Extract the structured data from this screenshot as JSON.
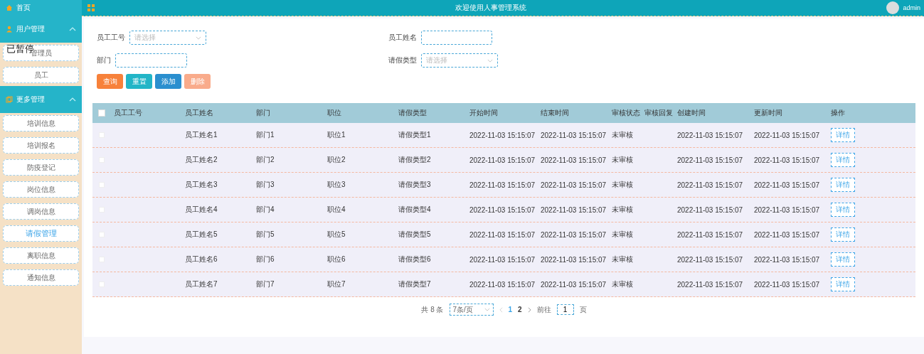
{
  "sidebar": {
    "home": "首页",
    "groups": [
      {
        "label": "用户管理",
        "expanded": true,
        "items": [
          {
            "label": "管理员",
            "selected": false
          },
          {
            "label": "员工",
            "selected": false
          }
        ]
      },
      {
        "label": "更多管理",
        "expanded": true,
        "items": [
          {
            "label": "培训信息",
            "selected": false
          },
          {
            "label": "培训报名",
            "selected": false
          },
          {
            "label": "防疫登记",
            "selected": false
          },
          {
            "label": "岗位信息",
            "selected": false
          },
          {
            "label": "调岗信息",
            "selected": false
          },
          {
            "label": "请假管理",
            "selected": true
          },
          {
            "label": "离职信息",
            "selected": false
          },
          {
            "label": "通知信息",
            "selected": false
          }
        ]
      }
    ]
  },
  "overlay": "已暂停",
  "header": {
    "title": "欢迎使用人事管理系统",
    "user": "admin"
  },
  "filters": [
    {
      "label": "员工工号",
      "kind": "select",
      "placeholder": "请选择"
    },
    {
      "label": "员工姓名",
      "kind": "input"
    },
    {
      "label": "部门",
      "kind": "input"
    },
    {
      "label": "请假类型",
      "kind": "select",
      "placeholder": "请选择"
    }
  ],
  "buttons": [
    {
      "label": "查询",
      "kind": "search"
    },
    {
      "label": "重置",
      "kind": "reset"
    },
    {
      "label": "添加",
      "kind": "add"
    },
    {
      "label": "删除",
      "kind": "delete"
    }
  ],
  "table": {
    "all_checked": false,
    "columns": [
      "员工工号",
      "员工姓名",
      "部门",
      "职位",
      "请假类型",
      "开始时间",
      "结束时间",
      "审核状态",
      "审核回复",
      "创建时间",
      "更新时间",
      "操作"
    ],
    "rows": [
      {
        "checked": false,
        "cells": [
          "",
          "员工姓名1",
          "部门1",
          "职位1",
          "请假类型1",
          "2022-11-03 15:15:07",
          "2022-11-03 15:15:07",
          "未审核",
          "",
          "2022-11-03 15:15:07",
          "2022-11-03 15:15:07"
        ],
        "action": "详情"
      },
      {
        "checked": false,
        "cells": [
          "",
          "员工姓名2",
          "部门2",
          "职位2",
          "请假类型2",
          "2022-11-03 15:15:07",
          "2022-11-03 15:15:07",
          "未审核",
          "",
          "2022-11-03 15:15:07",
          "2022-11-03 15:15:07"
        ],
        "action": "详情"
      },
      {
        "checked": false,
        "cells": [
          "",
          "员工姓名3",
          "部门3",
          "职位3",
          "请假类型3",
          "2022-11-03 15:15:07",
          "2022-11-03 15:15:07",
          "未审核",
          "",
          "2022-11-03 15:15:07",
          "2022-11-03 15:15:07"
        ],
        "action": "详情"
      },
      {
        "checked": false,
        "cells": [
          "",
          "员工姓名4",
          "部门4",
          "职位4",
          "请假类型4",
          "2022-11-03 15:15:07",
          "2022-11-03 15:15:07",
          "未审核",
          "",
          "2022-11-03 15:15:07",
          "2022-11-03 15:15:07"
        ],
        "action": "详情"
      },
      {
        "checked": false,
        "cells": [
          "",
          "员工姓名5",
          "部门5",
          "职位5",
          "请假类型5",
          "2022-11-03 15:15:07",
          "2022-11-03 15:15:07",
          "未审核",
          "",
          "2022-11-03 15:15:07",
          "2022-11-03 15:15:07"
        ],
        "action": "详情"
      },
      {
        "checked": false,
        "cells": [
          "",
          "员工姓名6",
          "部门6",
          "职位6",
          "请假类型6",
          "2022-11-03 15:15:07",
          "2022-11-03 15:15:07",
          "未审核",
          "",
          "2022-11-03 15:15:07",
          "2022-11-03 15:15:07"
        ],
        "action": "详情"
      },
      {
        "checked": false,
        "cells": [
          "",
          "员工姓名7",
          "部门7",
          "职位7",
          "请假类型7",
          "2022-11-03 15:15:07",
          "2022-11-03 15:15:07",
          "未审核",
          "",
          "2022-11-03 15:15:07",
          "2022-11-03 15:15:07"
        ],
        "action": "详情"
      }
    ]
  },
  "pagination": {
    "total": "共 8 条",
    "page_size": "7条/页",
    "pages": [
      {
        "label": "1",
        "selected": true
      },
      {
        "label": "2",
        "selected": false
      }
    ],
    "goto_label": "前往",
    "goto_value": "1",
    "goto_suffix": "页"
  }
}
